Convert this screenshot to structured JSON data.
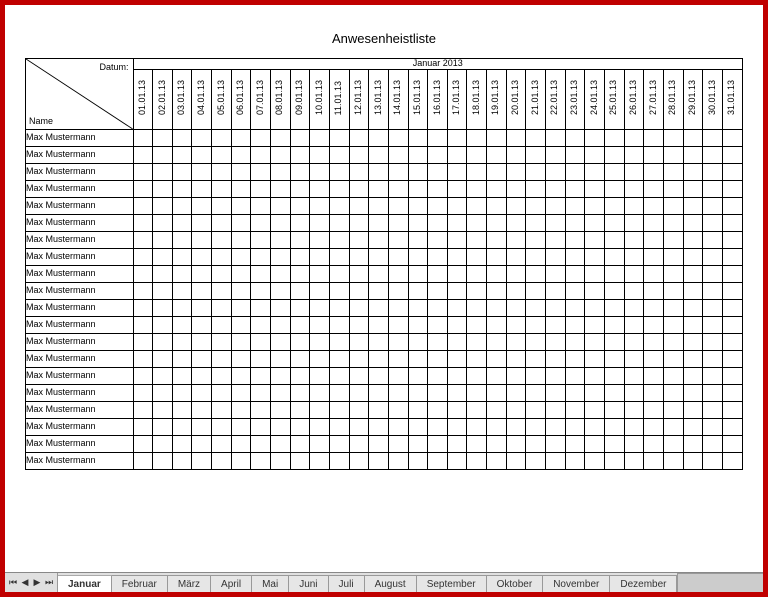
{
  "title": "Anwesenheistliste",
  "month_header": "Januar 2013",
  "corner": {
    "datum": "Datum:",
    "name": "Name"
  },
  "dates": [
    "01.01.13",
    "02.01.13",
    "03.01.13",
    "04.01.13",
    "05.01.13",
    "06.01.13",
    "07.01.13",
    "08.01.13",
    "09.01.13",
    "10.01.13",
    "11.01.13",
    "12.01.13",
    "13.01.13",
    "14.01.13",
    "15.01.13",
    "16.01.13",
    "17.01.13",
    "18.01.13",
    "19.01.13",
    "20.01.13",
    "21.01.13",
    "22.01.13",
    "23.01.13",
    "24.01.13",
    "25.01.13",
    "26.01.13",
    "27.01.13",
    "28.01.13",
    "29.01.13",
    "30.01.13",
    "31.01.13"
  ],
  "names": [
    "Max Mustermann",
    "Max Mustermann",
    "Max Mustermann",
    "Max Mustermann",
    "Max Mustermann",
    "Max Mustermann",
    "Max Mustermann",
    "Max Mustermann",
    "Max Mustermann",
    "Max Mustermann",
    "Max Mustermann",
    "Max Mustermann",
    "Max Mustermann",
    "Max Mustermann",
    "Max Mustermann",
    "Max Mustermann",
    "Max Mustermann",
    "Max Mustermann",
    "Max Mustermann",
    "Max Mustermann"
  ],
  "tabs": [
    {
      "label": "Januar",
      "active": true
    },
    {
      "label": "Februar",
      "active": false
    },
    {
      "label": "März",
      "active": false
    },
    {
      "label": "April",
      "active": false
    },
    {
      "label": "Mai",
      "active": false
    },
    {
      "label": "Juni",
      "active": false
    },
    {
      "label": "Juli",
      "active": false
    },
    {
      "label": "August",
      "active": false
    },
    {
      "label": "September",
      "active": false
    },
    {
      "label": "Oktober",
      "active": false
    },
    {
      "label": "November",
      "active": false
    },
    {
      "label": "Dezember",
      "active": false
    }
  ],
  "nav": {
    "first": "⏮",
    "prev": "◀",
    "next": "▶",
    "last": "⏭"
  }
}
